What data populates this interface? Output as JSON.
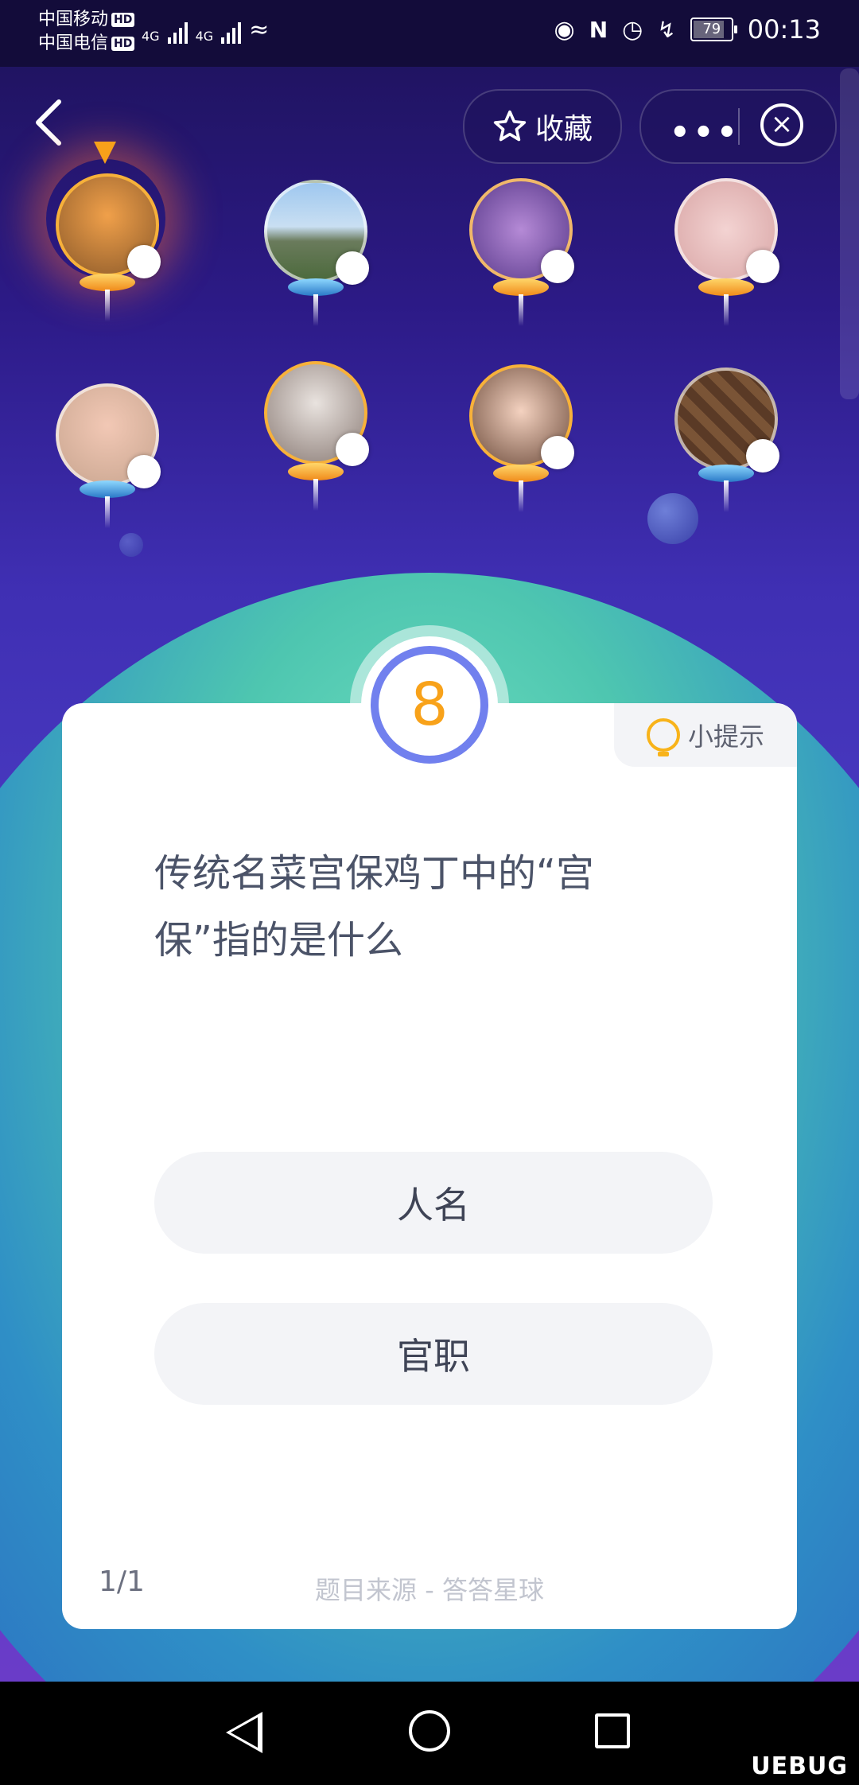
{
  "statusbar": {
    "carrier1": "中国移动",
    "carrier2": "中国电信",
    "hd": "HD",
    "network1": "4G",
    "network2": "4G",
    "battery": "79",
    "time": "00:13"
  },
  "header": {
    "favorite_label": "收藏"
  },
  "quiz": {
    "timer": "8",
    "hint_label": "小提示",
    "question": "传统名菜宫保鸡丁中的“宫保”指的是什么",
    "options": [
      "人名",
      "官职"
    ],
    "page": "1/1",
    "source": "题目来源 - 答答星球"
  },
  "watermark": "UEBUG",
  "colors": {
    "accent": "#f8a21a",
    "ring": "#7180ee"
  }
}
